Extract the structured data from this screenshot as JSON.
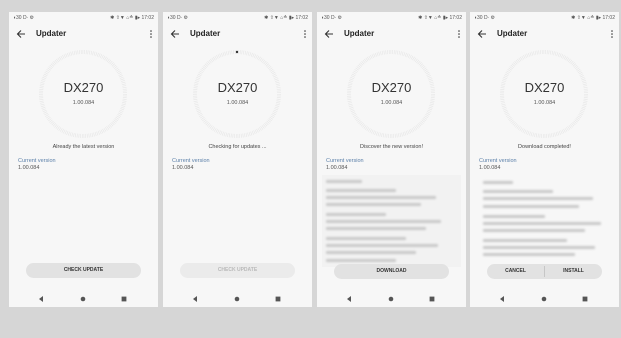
{
  "statusbar": {
    "left": "◖30 D· ⚙",
    "right": "✱ ⇧▼ ⌂≙ ▮▸ 17:02"
  },
  "app": {
    "title": "Updater",
    "back_icon": "arrow-left-icon",
    "more_icon": "more-vert-icon"
  },
  "device": {
    "name": "DX270",
    "version": "1.00.084"
  },
  "current_version": {
    "label": "Current version",
    "value": "1.00.084"
  },
  "screens": [
    {
      "status_message": "Already the latest version",
      "button_label": "CHECK UPDATE",
      "button_enabled": true
    },
    {
      "status_message": "Checking for updates ...",
      "button_label": "CHECK UPDATE",
      "button_enabled": false
    },
    {
      "status_message": "Discover the new version!",
      "button_label": "DOWNLOAD",
      "button_enabled": true
    },
    {
      "status_message": "Download completed!",
      "cancel_label": "CANCEL",
      "install_label": "INSTALL"
    }
  ],
  "colors": {
    "background": "#d6d6d6",
    "screen": "#f7f7f7",
    "accent": "#5a7fa8",
    "button": "#e2e2e2"
  }
}
